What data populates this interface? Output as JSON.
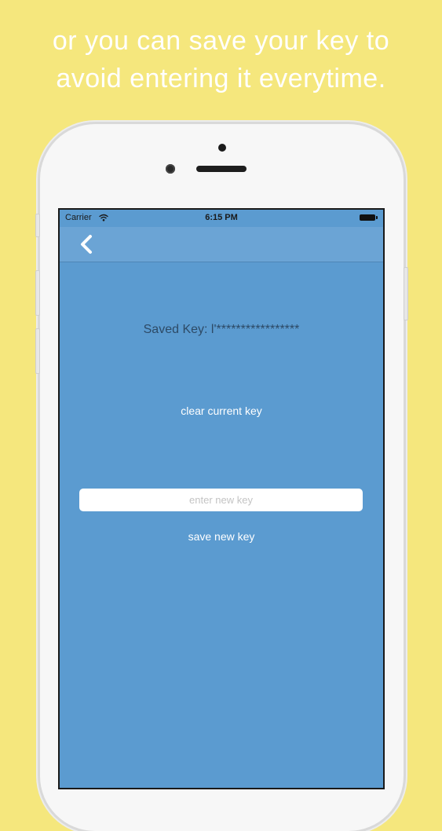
{
  "headline": {
    "line1": "or you can save your key to",
    "line2": "avoid entering it everytime."
  },
  "status_bar": {
    "carrier": "Carrier",
    "time": "6:15 PM"
  },
  "nav": {
    "back_icon": "chevron-left-icon"
  },
  "main": {
    "saved_key_text": "Saved Key: l'*****************",
    "clear_button_label": "clear current key",
    "new_key_placeholder": "enter new key",
    "new_key_value": "",
    "save_button_label": "save new key"
  },
  "colors": {
    "background": "#f5e77d",
    "screen": "#5b9bd0",
    "nav_bar": "#6ba4d5",
    "saved_key_text": "#2d4a66"
  }
}
